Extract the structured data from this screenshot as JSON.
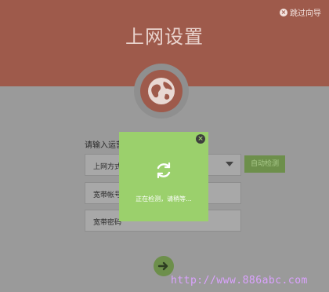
{
  "header": {
    "title": "上网设置",
    "skip_label": "跳过向导",
    "color": "#9e5a4b"
  },
  "form": {
    "prompt": "请输入运营",
    "rows": [
      {
        "label": "上网方式"
      },
      {
        "label": "宽带帐号"
      },
      {
        "label": "宽带密码"
      }
    ],
    "detect_button": "自动检测"
  },
  "modal": {
    "message": "正在检测，请稍等...",
    "accent": "#9bd06c"
  },
  "icons": {
    "skip": "close-circle-icon",
    "globe": "globe-icon",
    "next": "arrow-right-icon",
    "spinner": "refresh-icon",
    "modal_close": "close-icon"
  },
  "watermark": "http://www.886abc.com"
}
